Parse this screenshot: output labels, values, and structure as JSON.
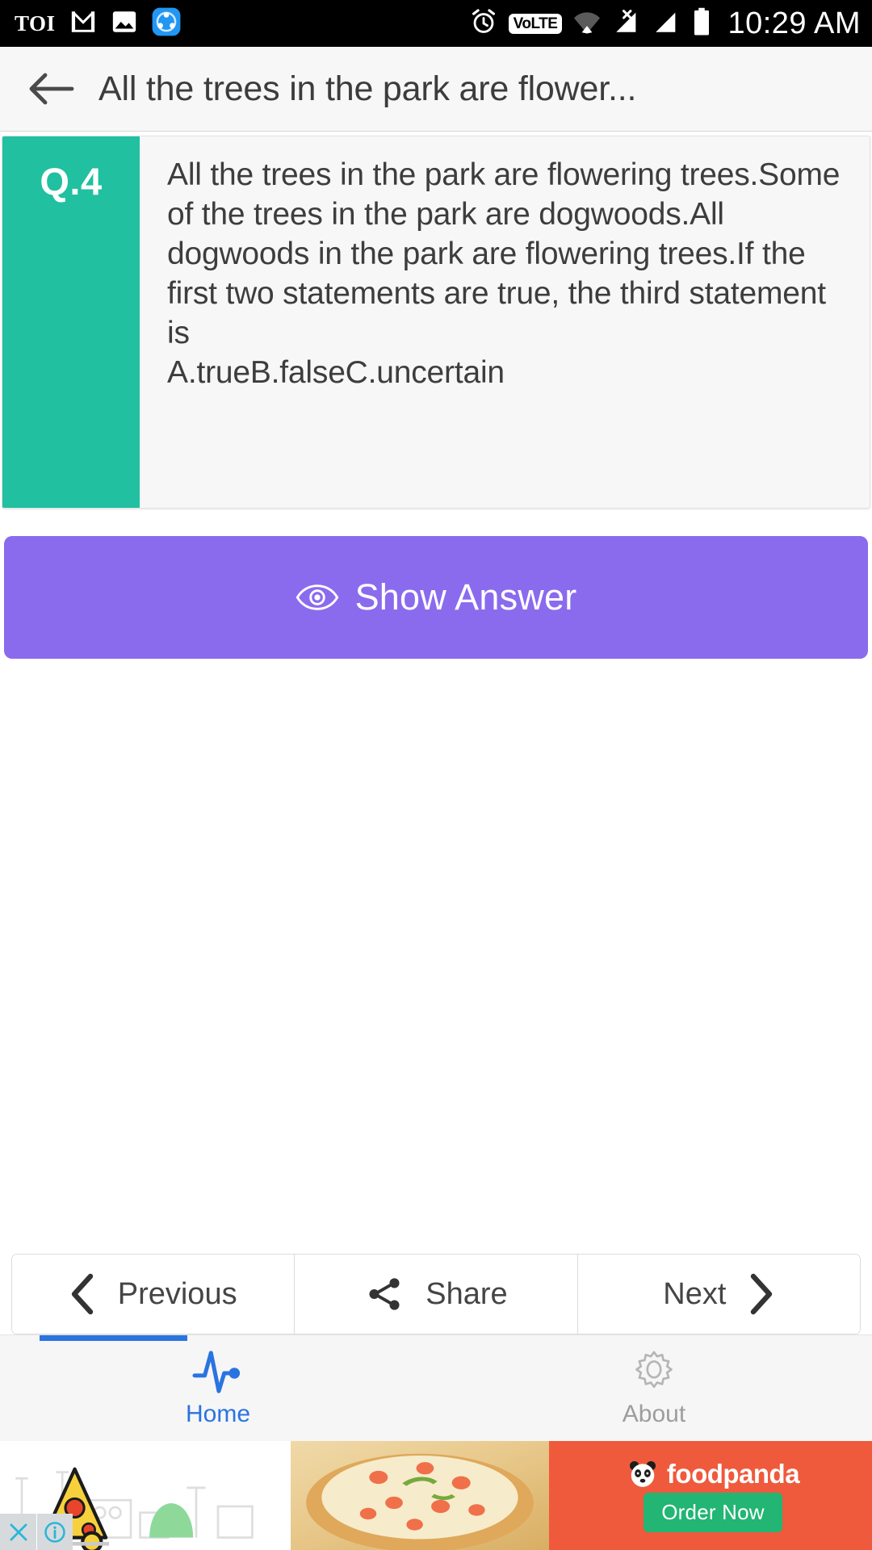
{
  "statusbar": {
    "time": "10:29 AM",
    "toi_label": "TOI",
    "volte_label": "VoLTE",
    "icons": [
      "toi-logo",
      "gmail-icon",
      "photos-icon",
      "shareit-icon",
      "alarm-icon",
      "volte-icon",
      "wifi-icon",
      "signal-no-sim-icon",
      "signal-bars-icon",
      "battery-icon"
    ]
  },
  "appbar": {
    "title": "All the trees in the park are flower...",
    "back_icon": "back-arrow-icon"
  },
  "question": {
    "number_label": "Q.4",
    "text": "All the trees in the park are flowering trees.Some of the trees in the park are dogwoods.All dogwoods in the park are flowering trees.If the first two statements are true, the third statement is\nA.trueB.falseC.uncertain",
    "badge_color": "#20c0a0"
  },
  "show_answer": {
    "label": "Show Answer",
    "icon": "eye-icon",
    "color": "#8a6bee"
  },
  "nav": {
    "previous_label": "Previous",
    "previous_icon": "chevron-left-icon",
    "share_label": "Share",
    "share_icon": "share-icon",
    "next_label": "Next",
    "next_icon": "chevron-right-icon"
  },
  "tabs": [
    {
      "label": "Home",
      "icon": "pulse-icon",
      "active": true,
      "color": "#2a74e0"
    },
    {
      "label": "About",
      "icon": "gear-icon",
      "active": false,
      "color": "#9d9d9d"
    }
  ],
  "ad": {
    "brand": "foodpanda",
    "cta_label": "Order Now",
    "brand_icon": "panda-icon",
    "close_icon": "close-icon",
    "info_icon": "info-icon",
    "brand_color": "#ef5a3c",
    "cta_color": "#22b573"
  }
}
